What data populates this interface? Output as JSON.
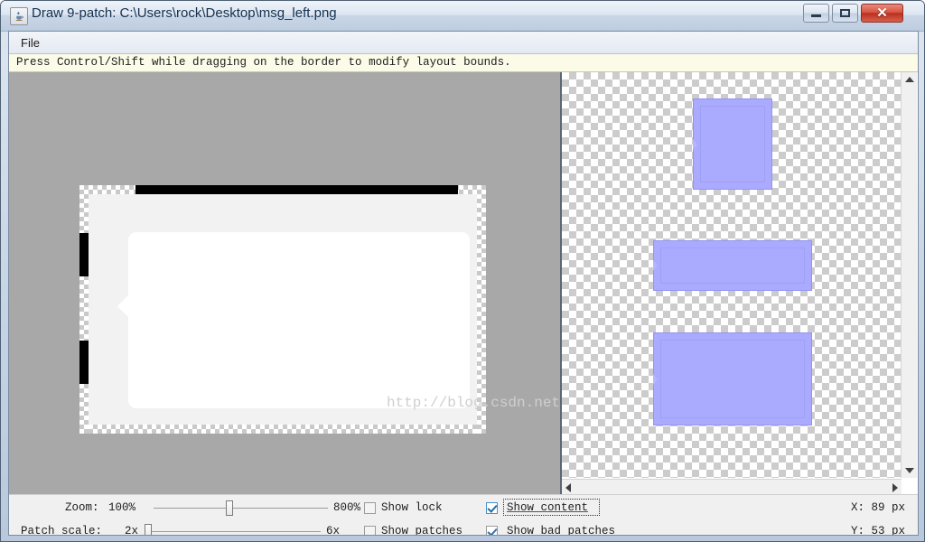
{
  "window": {
    "title": "Draw 9-patch: C:\\Users\\rock\\Desktop\\msg_left.png",
    "app_icon": "java-cup-icon",
    "minimize_label": "",
    "maximize_label": "",
    "close_label": "✕"
  },
  "menubar": {
    "items": [
      {
        "label": "File"
      }
    ]
  },
  "hint": {
    "text": "Press Control/Shift while dragging on the border to modify layout bounds."
  },
  "editor": {
    "watermark": "http://blog.csdn.net",
    "background_color": "#a8a8a8",
    "patch_background": "#f2f2f2",
    "bubble_color": "#ffffff",
    "stretch_marker_color": "#000000"
  },
  "preview": {
    "checker_color": "#cccccc",
    "patch_color": "#aaaaff",
    "patch_border_color": "#9494f0",
    "previews": [
      {
        "name": "preview-small"
      },
      {
        "name": "preview-wide-short"
      },
      {
        "name": "preview-wide-tall"
      }
    ],
    "scroll_up": "▲",
    "scroll_down": "▼",
    "scroll_left": "◀",
    "scroll_right": "▶"
  },
  "controls": {
    "zoom_label": "Zoom:",
    "zoom_min": "100%",
    "zoom_max": "800%",
    "zoom_value_percent": 45,
    "patch_scale_label": "Patch scale:",
    "patch_scale_min": "2x",
    "patch_scale_max": "6x",
    "patch_scale_value_percent": 0,
    "show_lock_label": "Show lock",
    "show_lock_checked": false,
    "show_patches_label": "Show patches",
    "show_patches_checked": false,
    "show_content_label": "Show content",
    "show_content_checked": true,
    "show_content_focused": true,
    "show_bad_patches_label": "Show bad patches",
    "show_bad_patches_checked": true,
    "coord_x": "X: 89 px",
    "coord_y": "Y: 53 px"
  }
}
